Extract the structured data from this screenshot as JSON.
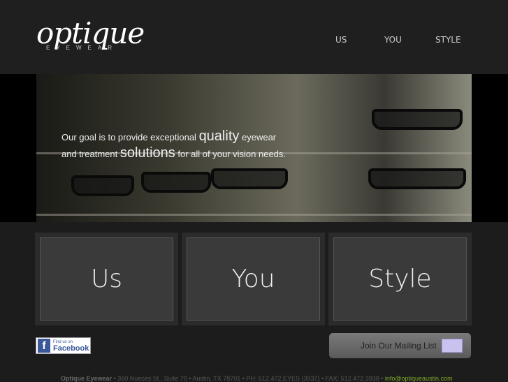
{
  "logo": {
    "word": "optique",
    "sub": "EYEWEAR"
  },
  "nav": [
    {
      "label": "US"
    },
    {
      "label": "YOU"
    },
    {
      "label": "STYLE"
    }
  ],
  "hero": {
    "line1_a": "Our goal is to provide exceptional ",
    "line1_b": "quality",
    "line1_c": " eyewear",
    "line2_a": "and treatment ",
    "line2_b": "solutions",
    "line2_c": " for all of your vision needs."
  },
  "panels": [
    {
      "label": "Us"
    },
    {
      "label": "You"
    },
    {
      "label": "Style"
    }
  ],
  "facebook": {
    "small": "Find us on",
    "big": "Facebook",
    "icon": "f"
  },
  "mailing": {
    "label": "Join Our Mailing List"
  },
  "footer": {
    "name": "Optique Eyewear",
    "details": " • 360 Nueces St., Suite 70 • Austin, TX 78701 • PH: 512.472.EYES (3937) • FAX: 512.472.3938 • ",
    "email": "info@optiqueaustin.com"
  }
}
